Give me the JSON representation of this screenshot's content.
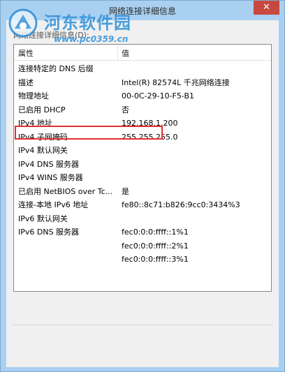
{
  "window": {
    "title": "网络连接详细信息",
    "close_glyph": "✕"
  },
  "watermark": {
    "title": "河东软件园",
    "url": "www.pc0359.cn"
  },
  "details_label": "网络连接详细信息(D):",
  "columns": {
    "property": "属性",
    "value": "值"
  },
  "rows": [
    {
      "property": "连接特定的 DNS 后缀",
      "value": ""
    },
    {
      "property": "描述",
      "value": "Intel(R) 82574L 千兆网络连接"
    },
    {
      "property": "物理地址",
      "value": "00-0C-29-10-F5-B1"
    },
    {
      "property": "已启用 DHCP",
      "value": "否"
    },
    {
      "property": "IPv4 地址",
      "value": "192.168.1.200"
    },
    {
      "property": "IPv4 子网掩码",
      "value": "255.255.255.0"
    },
    {
      "property": "IPv4 默认网关",
      "value": ""
    },
    {
      "property": "IPv4 DNS 服务器",
      "value": ""
    },
    {
      "property": "IPv4 WINS 服务器",
      "value": ""
    },
    {
      "property": "已启用 NetBIOS over Tc...",
      "value": "是"
    },
    {
      "property": "连接-本地 IPv6 地址",
      "value": "fe80::8c71:b826:9cc0:3434%3"
    },
    {
      "property": "IPv6 默认网关",
      "value": ""
    },
    {
      "property": "IPv6 DNS 服务器",
      "value": "fec0:0:0:ffff::1%1"
    },
    {
      "property": "",
      "value": "fec0:0:0:ffff::2%1"
    },
    {
      "property": "",
      "value": "fec0:0:0:ffff::3%1"
    }
  ],
  "colors": {
    "highlight": "#e03030",
    "frame": "#a9d0f1",
    "close": "#c7483e"
  }
}
